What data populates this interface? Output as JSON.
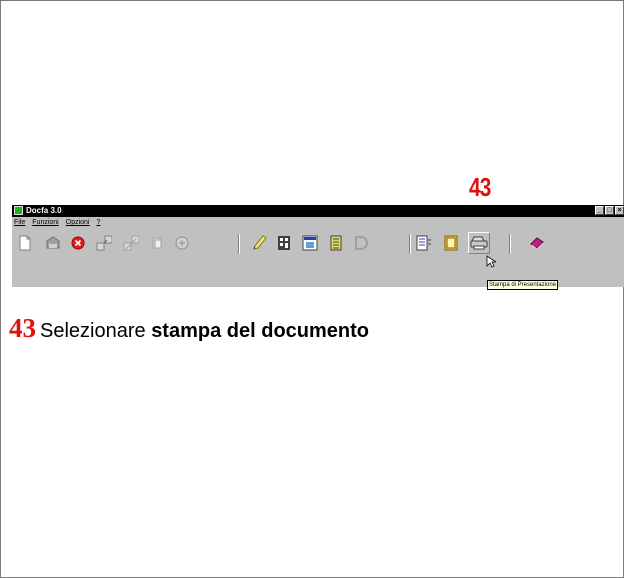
{
  "step_marker": "43",
  "window": {
    "title": "Docfa 3.0",
    "controls": {
      "minimize": "_",
      "maximize": "□",
      "close": "×"
    }
  },
  "menu": [
    "File",
    "Funzioni",
    "Opzioni",
    "?"
  ],
  "toolbar": {
    "icons": [
      "new-document-icon",
      "open-folder-icon",
      "delete-icon",
      "transfer-icon",
      "transfer-disabled-icon",
      "copy-icon",
      "tools-icon",
      "check-icon",
      "calculator-icon",
      "form-icon",
      "list-icon",
      "disabled-icon",
      "report-icon",
      "document-icon",
      "printer-icon",
      "book-icon"
    ],
    "tooltip": "Stampa di Presentazione"
  },
  "instruction": {
    "number": "43",
    "text": "Selezionare ",
    "bold_text": "stampa del documento"
  },
  "colors": {
    "accent_red": "#e01010",
    "titlebar": "#000000",
    "window_bg": "#c0c0c0"
  }
}
